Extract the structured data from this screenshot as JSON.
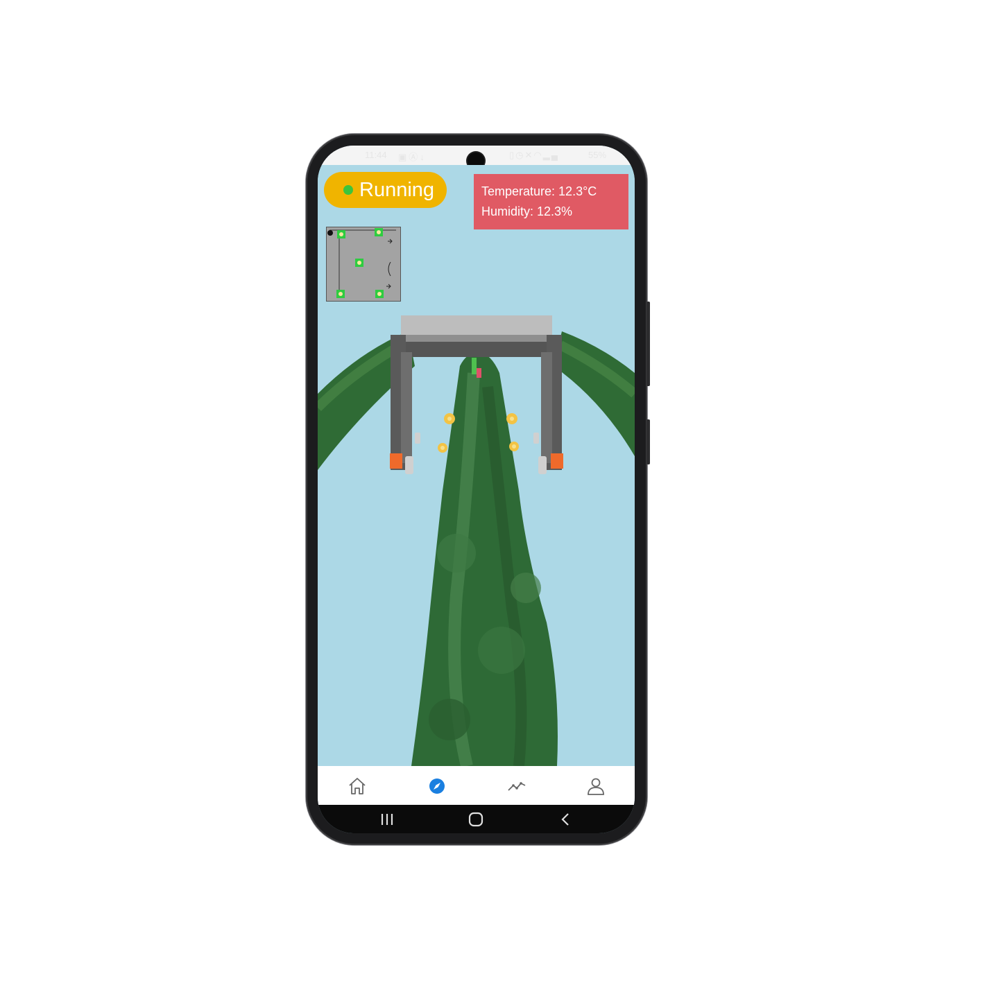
{
  "status_bar": {
    "time": "11:44",
    "left_icons": [
      "image-icon",
      "a-circle-icon",
      "download-icon"
    ],
    "right_icons": [
      "sim-icon",
      "alarm-icon",
      "mute-icon",
      "wifi-icon",
      "signal-icon"
    ],
    "battery": "55%"
  },
  "robot_status": {
    "label": "Running",
    "indicator_color": "#3cc43c",
    "pill_color": "#f0b400"
  },
  "environment": {
    "temperature": "Temperature: 12.3°C",
    "humidity": "Humidity: 12.3%",
    "box_color": "#e05a64"
  },
  "bottom_nav": {
    "items": [
      {
        "icon": "home-icon",
        "active": false
      },
      {
        "icon": "compass-icon",
        "active": true
      },
      {
        "icon": "chart-line-icon",
        "active": false
      },
      {
        "icon": "user-icon",
        "active": false
      }
    ],
    "active_color": "#1a7fe0"
  },
  "system_nav": {
    "buttons": [
      "recents-icon",
      "home-button-icon",
      "back-icon"
    ]
  }
}
